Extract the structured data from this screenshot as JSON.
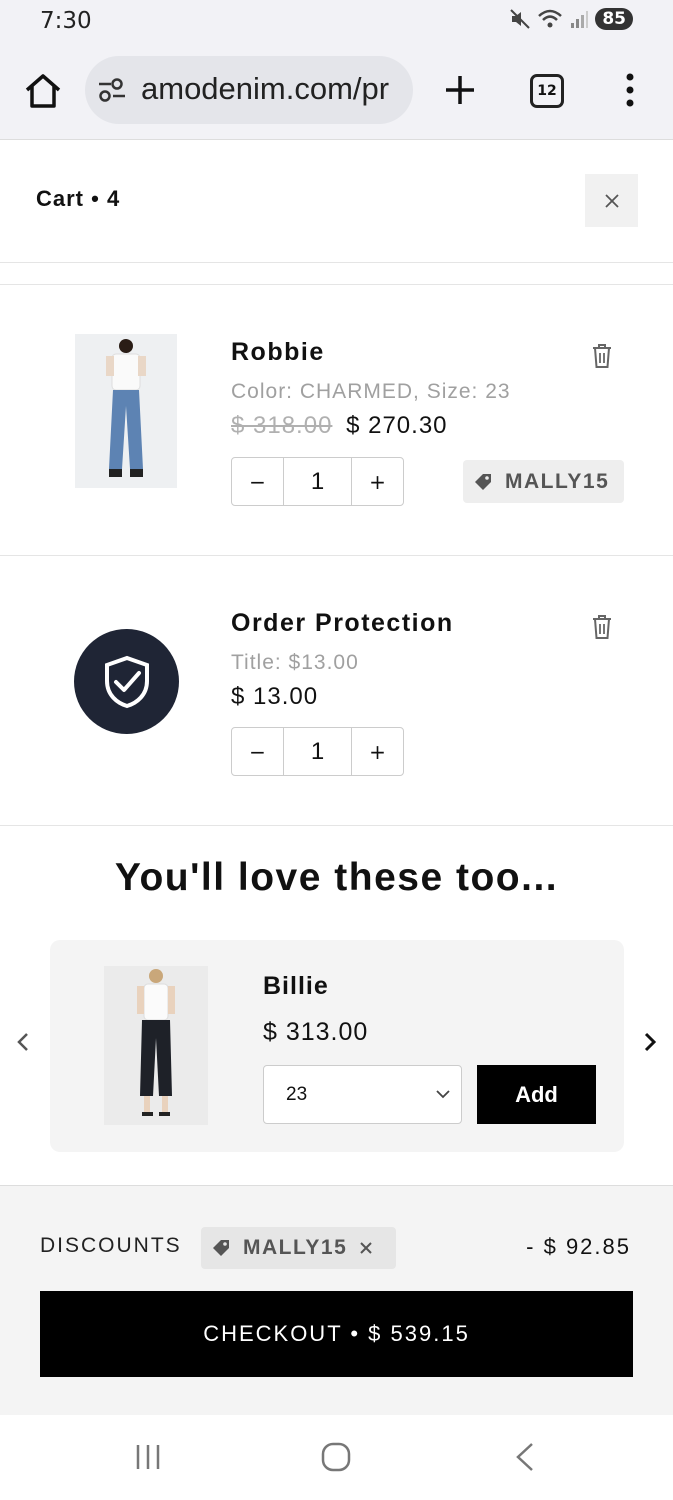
{
  "status": {
    "time": "7:30",
    "battery": "85"
  },
  "browser": {
    "url": "amodenim.com/pr",
    "tab_count": "12"
  },
  "cart": {
    "title": "Cart • 4"
  },
  "items": [
    {
      "name": "Robbie",
      "variant": "Color: CHARMED, Size: 23",
      "old_price": "$ 318.00",
      "price": "$ 270.30",
      "qty": "1",
      "coupon": "MALLY15"
    },
    {
      "name": "Order Protection",
      "variant": "Title: $13.00",
      "price": "$ 13.00",
      "qty": "1"
    }
  ],
  "qty_controls": {
    "minus": "−",
    "plus": "+"
  },
  "recommendations": {
    "title": "You'll love these too...",
    "product": {
      "name": "Billie",
      "price": "$ 313.00",
      "size": "23",
      "add_label": "Add"
    }
  },
  "footer": {
    "discounts_label": "DISCOUNTS",
    "discount_code": "MALLY15",
    "discount_amount": "- $ 92.85",
    "checkout_label": "CHECKOUT • $ 539.15"
  },
  "colors": {
    "dark_navy": "#1f2535",
    "black": "#000000"
  }
}
